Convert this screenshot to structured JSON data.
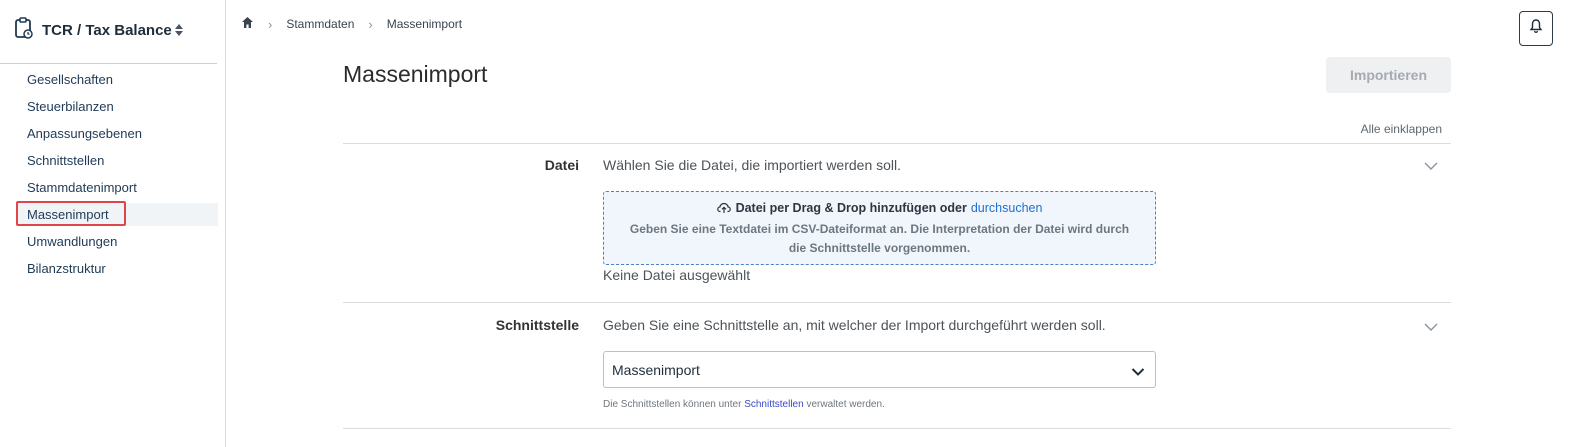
{
  "app": {
    "title": "TCR / Tax Balance"
  },
  "sidebar": {
    "items": [
      {
        "label": "Gesellschaften"
      },
      {
        "label": "Steuerbilanzen"
      },
      {
        "label": "Anpassungsebenen"
      },
      {
        "label": "Schnittstellen"
      },
      {
        "label": "Stammdatenimport"
      },
      {
        "label": "Massenimport"
      },
      {
        "label": "Umwandlungen"
      },
      {
        "label": "Bilanzstruktur"
      }
    ],
    "active_index": 5
  },
  "breadcrumb": {
    "item1": "Stammdaten",
    "item2": "Massenimport"
  },
  "page": {
    "title": "Massenimport",
    "import_button": "Importieren",
    "collapse_all": "Alle einklappen"
  },
  "sections": {
    "file": {
      "label": "Datei",
      "description": "Wählen Sie die Datei, die importiert werden soll.",
      "dropzone_text": "Datei per Drag & Drop hinzufügen oder",
      "dropzone_link": "durchsuchen",
      "dropzone_hint": "Geben Sie eine Textdatei im CSV-Dateiformat an. Die Interpretation der Datei wird durch die Schnittstelle vorgenommen.",
      "status": "Keine Datei ausgewählt"
    },
    "interface": {
      "label": "Schnittstelle",
      "description": "Geben Sie eine Schnittstelle an, mit welcher der Import durchgeführt werden soll.",
      "selected": "Massenimport",
      "helper_prefix": "Die Schnittstellen können unter",
      "helper_link": "Schnittstellen",
      "helper_suffix": "verwaltet werden."
    }
  },
  "colors": {
    "accent": "#1f6fd1",
    "highlight": "#e0454a"
  }
}
